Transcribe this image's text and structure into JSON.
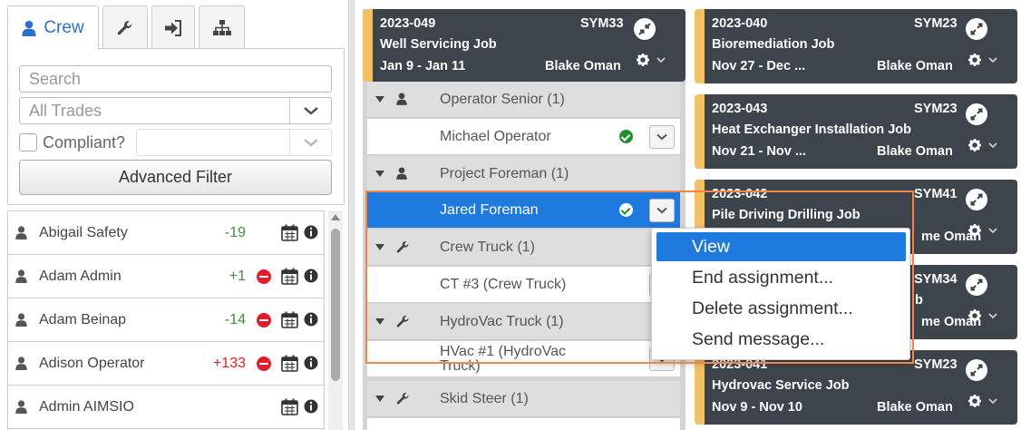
{
  "sidebar": {
    "tabs": [
      {
        "label": "Crew",
        "icon": "user-icon",
        "active": true
      },
      {
        "label": "",
        "icon": "wrench-icon"
      },
      {
        "label": "",
        "icon": "sign-in-icon"
      },
      {
        "label": "",
        "icon": "sitemap-icon"
      }
    ],
    "search_placeholder": "Search",
    "trades_placeholder": "All Trades",
    "compliant_label": "Compliant?",
    "advanced_filter_label": "Advanced Filter",
    "crew": [
      {
        "name": "Abigail Safety",
        "count": "-19",
        "count_color": "green",
        "blocked": false
      },
      {
        "name": "Adam Admin",
        "count": "+1",
        "count_color": "red",
        "blocked": true
      },
      {
        "name": "Adam Beinap",
        "count": "-14",
        "count_color": "green",
        "blocked": true
      },
      {
        "name": "Adison Operator",
        "count": "+133",
        "count_color": "red",
        "blocked": true
      },
      {
        "name": "Admin AIMSIO",
        "count": "",
        "count_color": "",
        "blocked": false
      }
    ]
  },
  "main_job": {
    "code": "2023-049",
    "sym": "SYM33",
    "title": "Well Servicing Job",
    "dates": "Jan 9 - Jan 11",
    "owner": "Blake Oman",
    "groups": [
      {
        "label": "Operator Senior (1)",
        "icon": "user-icon",
        "assignment": "Michael Operator",
        "ok": true,
        "selected": false
      },
      {
        "label": "Project Foreman (1)",
        "icon": "user-icon",
        "assignment": "Jared Foreman",
        "ok": true,
        "selected": true
      },
      {
        "label": "Crew Truck (1)",
        "icon": "wrench-icon",
        "assignment": "CT #3 (Crew Truck)",
        "ok": false,
        "selected": false
      },
      {
        "label": "HydroVac Truck (1)",
        "icon": "wrench-icon",
        "assignment_line1": "HVac #1 (HydroVac",
        "assignment_line2": "Truck)",
        "ok": false,
        "selected": false
      },
      {
        "label": "Skid Steer (1)",
        "icon": "wrench-icon"
      }
    ]
  },
  "job_cards": [
    {
      "code": "2023-040",
      "sym": "SYM23",
      "title": "Bioremediation Job",
      "dates": "Nov 27 - Dec ...",
      "owner": "Blake Oman"
    },
    {
      "code": "2023-043",
      "sym": "SYM23",
      "title": "Heat Exchanger Installation Job",
      "dates": "Nov 21 - Nov ...",
      "owner": "Blake Oman"
    },
    {
      "code": "2023-042",
      "sym": "SYM41",
      "title": "Pile Driving Drilling Job",
      "dates": "",
      "owner": "me Oman"
    },
    {
      "code": "",
      "sym": "SYM34",
      "title": "b",
      "dates": "",
      "owner": "me Oman"
    },
    {
      "code": "2023-041",
      "sym": "SYM23",
      "title": "Hydrovac Service Job",
      "dates": "Nov 9 - Nov 10",
      "owner": "Blake Oman"
    }
  ],
  "context_menu": {
    "items": [
      "View",
      "End assignment...",
      "Delete assignment...",
      "Send message..."
    ],
    "active": "View"
  },
  "colors": {
    "accent": "#1f7ae0",
    "card_bg": "#3e444b",
    "card_stripe": "#f2c166",
    "highlight": "#f0864a",
    "ok_green": "#1f8f2e",
    "block_red": "#e21d2c"
  }
}
